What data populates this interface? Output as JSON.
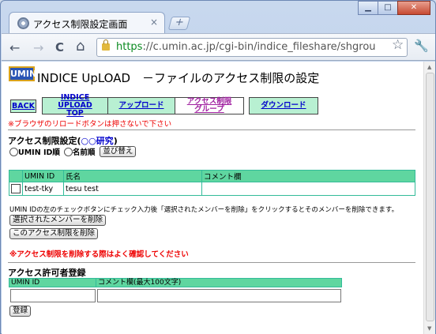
{
  "browser": {
    "tab_title": "アクセス制限設定画面",
    "tab_close": "×",
    "new_tab": "+",
    "url_scheme": "https",
    "url_rest": "://c.umin.ac.jp/cgi-bin/indice_fileshare/shgrou",
    "window_controls": {
      "minimize": "▁",
      "maximize": "□",
      "close": "✕"
    },
    "nav_icons": {
      "back": "←",
      "forward": "→",
      "reload": "C",
      "home": "⌂",
      "star": "☆",
      "wrench": "🔧"
    }
  },
  "page": {
    "logo_text": "UMIN",
    "title": "INDICE UpLOAD　－ファイルのアクセス制限の設定",
    "nav": {
      "back": "BACK",
      "top_line1": "INDICE UPLOAD",
      "top_line2": "TOP",
      "upload": "アップロード",
      "group_line1": "アクセス制限",
      "group_line2": "グループ",
      "download": "ダウンロード"
    },
    "reload_warning": "※ブラウザのリロードボタンは押さないで下さい",
    "access_title_prefix": "アクセス制限設定(",
    "access_title_link": "○○研究",
    "access_title_suffix": ")",
    "sort": {
      "option_umin": "UMIN ID順",
      "option_name": "名前順",
      "button": "並び替え"
    },
    "member_table": {
      "headers": [
        "",
        "UMIN ID",
        "氏名",
        "コメント欄"
      ],
      "rows": [
        {
          "umin_id": "test-tky",
          "name": "tesu test",
          "comment": ""
        }
      ]
    },
    "description": "UMIN IDの左のチェックボタンにチェック入力後「選択されたメンバーを削除」をクリックするとそのメンバーを削除できます。",
    "delete_selected_button": "選択されたメンバーを削除",
    "delete_restriction_button": "このアクセス制限を削除",
    "delete_warning": "※アクセス制限を削除する際はよく確認してください",
    "register": {
      "title": "アクセス許可者登録",
      "header_umin": "UMIN ID",
      "header_comment": "コメント欄(最大100文字)",
      "umin_value": "",
      "comment_value": "",
      "button": "登録"
    }
  }
}
